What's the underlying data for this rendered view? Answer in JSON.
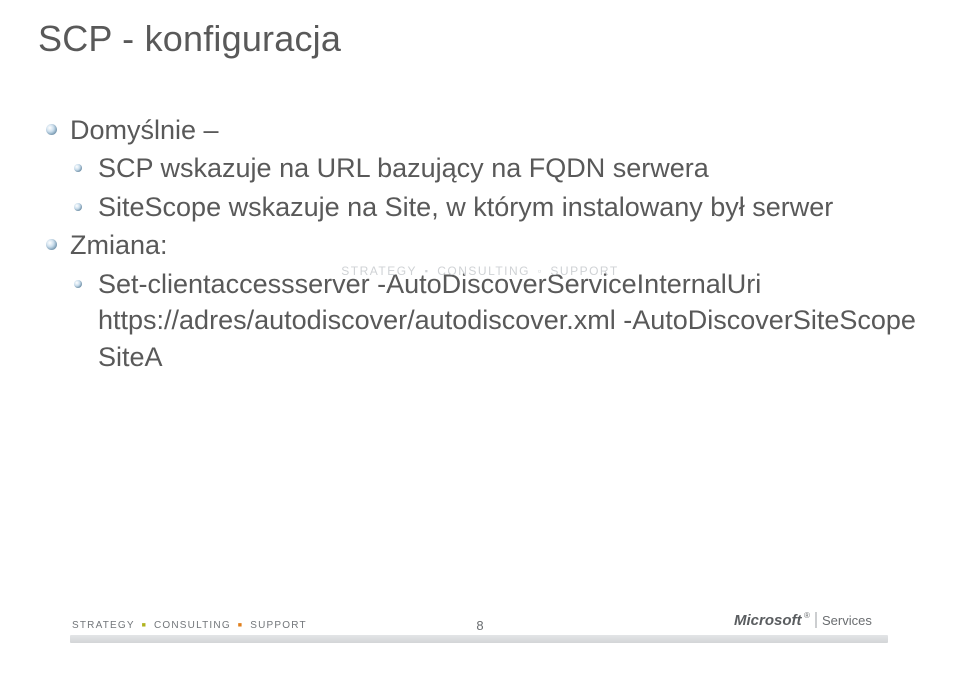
{
  "title": "SCP - konfiguracja",
  "bullets": {
    "b1": "Domyślnie –",
    "b1a": "SCP wskazuje na URL bazujący na FQDN serwera",
    "b1b": "SiteScope wskazuje na Site, w którym instalowany był serwer",
    "b2": "Zmiana:",
    "b2a": "Set-clientaccessserver -AutoDiscoverServiceInternalUri https://adres/autodiscover/autodiscover.xml -AutoDiscoverSiteScope SiteA"
  },
  "watermark": {
    "w1": "STRATEGY",
    "w2": "CONSULTING",
    "w3": "SUPPORT"
  },
  "footer": {
    "t1": "STRATEGY",
    "t2": "CONSULTING",
    "t3": "SUPPORT",
    "page": "8",
    "brand": "Microsoft",
    "brandSub": "Services"
  }
}
